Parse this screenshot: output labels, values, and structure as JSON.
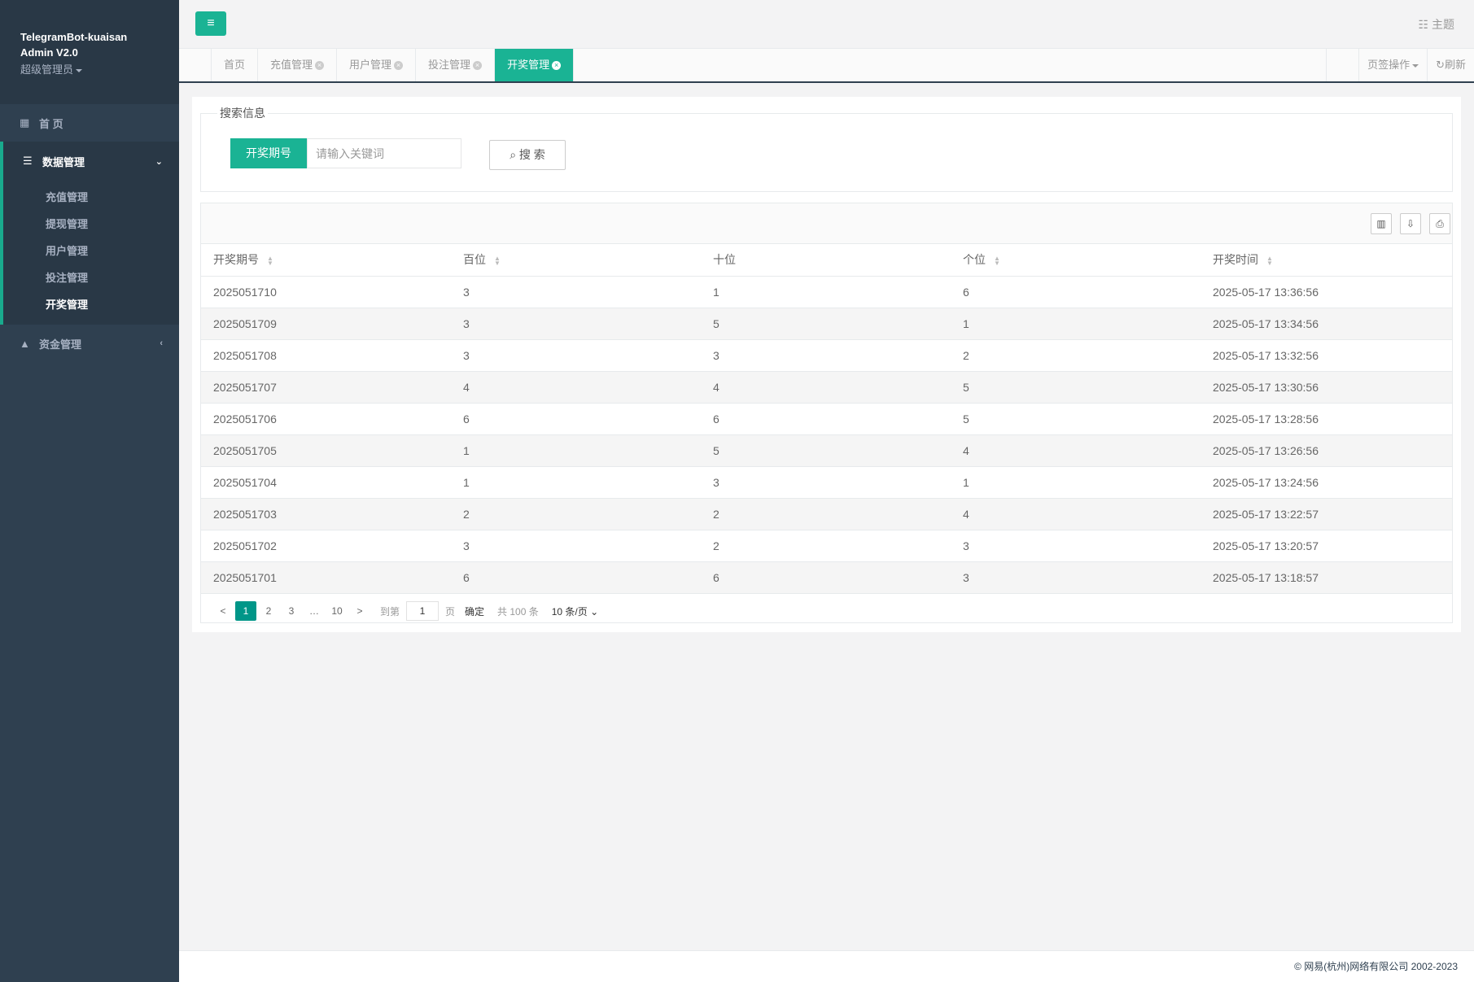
{
  "brand": {
    "title_line1": "TelegramBot-kuaisan",
    "title_line2": "Admin V2.0",
    "role": "超级管理员"
  },
  "sidebar": {
    "home": "首 页",
    "data_group": "数据管理",
    "data_items": [
      "充值管理",
      "提现管理",
      "用户管理",
      "投注管理",
      "开奖管理"
    ],
    "funds_group": "资金管理"
  },
  "topbar": {
    "theme": "主题"
  },
  "tabs": [
    {
      "label": "首页"
    },
    {
      "label": "充值管理"
    },
    {
      "label": "用户管理"
    },
    {
      "label": "投注管理"
    },
    {
      "label": "开奖管理"
    }
  ],
  "tab_tools": {
    "page_ops": "页签操作",
    "refresh": "刷新"
  },
  "search": {
    "legend": "搜索信息",
    "field_label": "开奖期号",
    "placeholder": "请输入关键词",
    "button": "搜 索"
  },
  "table": {
    "headers": [
      "开奖期号",
      "百位",
      "十位",
      "个位",
      "开奖时间"
    ],
    "rows": [
      [
        "2025051710",
        "3",
        "1",
        "6",
        "2025-05-17 13:36:56"
      ],
      [
        "2025051709",
        "3",
        "5",
        "1",
        "2025-05-17 13:34:56"
      ],
      [
        "2025051708",
        "3",
        "3",
        "2",
        "2025-05-17 13:32:56"
      ],
      [
        "2025051707",
        "4",
        "4",
        "5",
        "2025-05-17 13:30:56"
      ],
      [
        "2025051706",
        "6",
        "6",
        "5",
        "2025-05-17 13:28:56"
      ],
      [
        "2025051705",
        "1",
        "5",
        "4",
        "2025-05-17 13:26:56"
      ],
      [
        "2025051704",
        "1",
        "3",
        "1",
        "2025-05-17 13:24:56"
      ],
      [
        "2025051703",
        "2",
        "2",
        "4",
        "2025-05-17 13:22:57"
      ],
      [
        "2025051702",
        "3",
        "2",
        "3",
        "2025-05-17 13:20:57"
      ],
      [
        "2025051701",
        "6",
        "6",
        "3",
        "2025-05-17 13:18:57"
      ]
    ]
  },
  "pager": {
    "prev": "<",
    "pages": [
      "1",
      "2",
      "3"
    ],
    "ellipsis": "…",
    "last": "10",
    "next": ">",
    "goto_label": "到第",
    "goto_value": "1",
    "page_unit": "页",
    "confirm": "确定",
    "total": "共 100 条",
    "page_size": "10 条/页"
  },
  "footer": {
    "copyright": "© 网易(杭州)网络有限公司 2002-2023"
  }
}
